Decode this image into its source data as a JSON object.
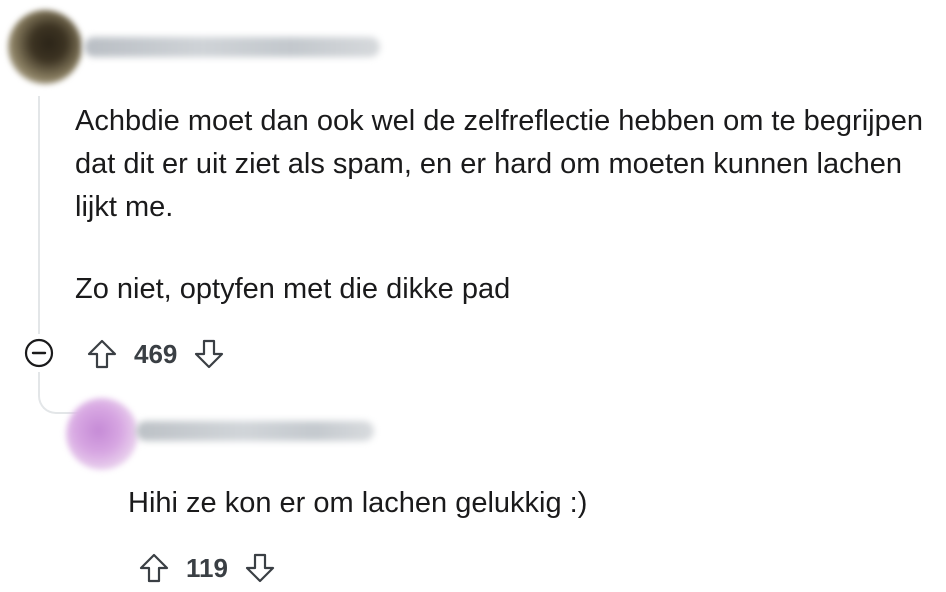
{
  "comment_1": {
    "paragraphs": [
      "Achbdie moet dan ook wel de zelfreflectie hebben om te begrijpen dat dit er uit ziet als spam, en er hard om moeten kunnen lachen lijkt me.",
      "Zo niet, optyfen met die dikke pad"
    ],
    "score": "469",
    "icons": {
      "upvote": "arrow-up-outline-icon",
      "downvote": "arrow-down-outline-icon",
      "collapse": "minus-circle-icon"
    }
  },
  "comment_2": {
    "paragraphs": [
      "Hihi ze kon er om lachen gelukkig :)"
    ],
    "score": "119",
    "icons": {
      "upvote": "arrow-up-outline-icon",
      "downvote": "arrow-down-outline-icon"
    }
  },
  "colors": {
    "text": "#1a1a1b",
    "meta": "#3a3f44",
    "thread_line": "#e3e6e8"
  }
}
